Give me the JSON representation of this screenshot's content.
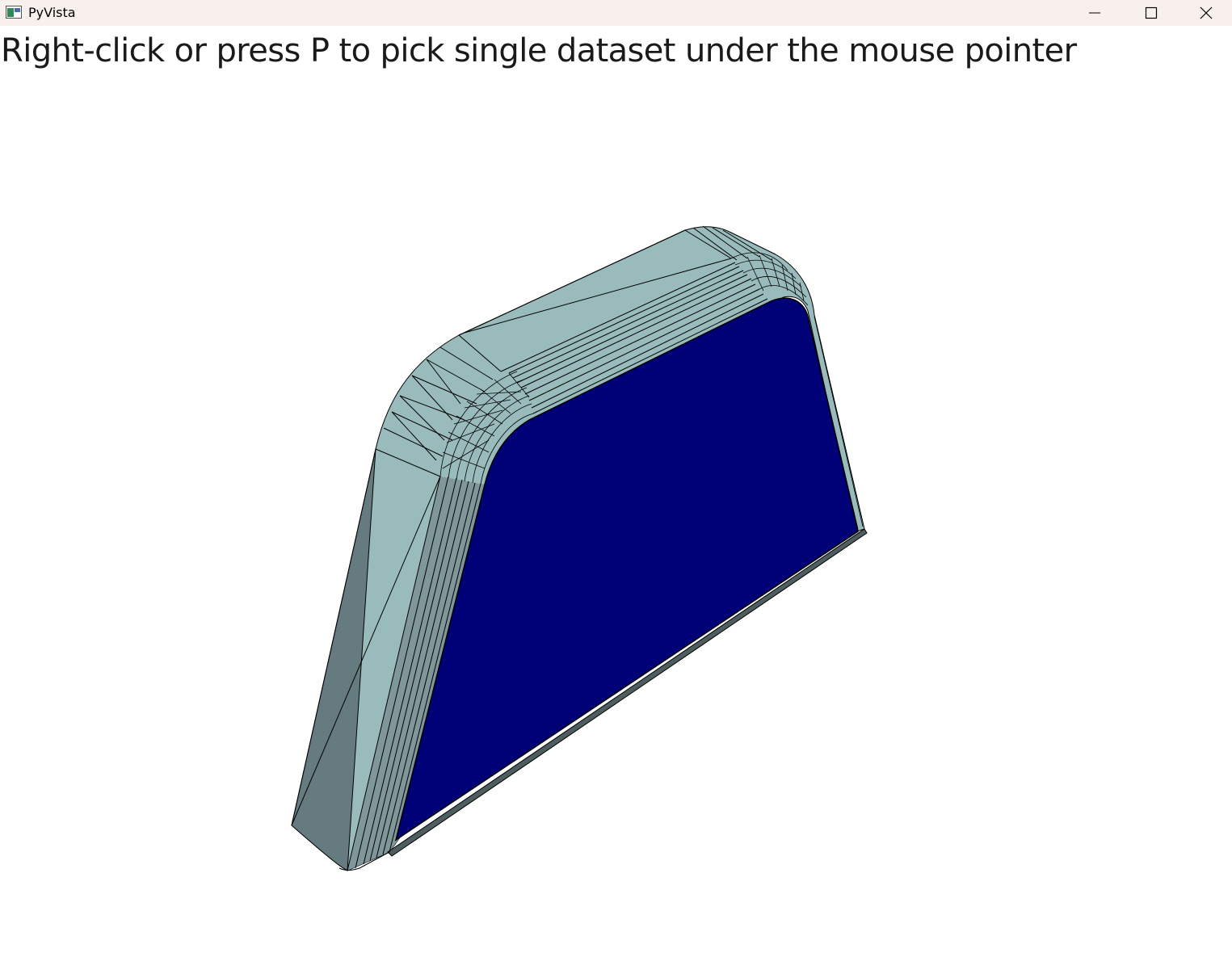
{
  "window": {
    "title": "PyVista",
    "controls": {
      "minimize": "minimize-icon",
      "maximize": "maximize-icon",
      "close": "close-icon"
    }
  },
  "viewport": {
    "overlay_text": "Right-click or press P to pick single dataset under the mouse pointer",
    "background_color": "#ffffff"
  },
  "mesh": {
    "side_color_light": "#9abbbb",
    "side_color_dark": "#667b7f",
    "face_color": "#000077",
    "edge_color": "#000000"
  }
}
